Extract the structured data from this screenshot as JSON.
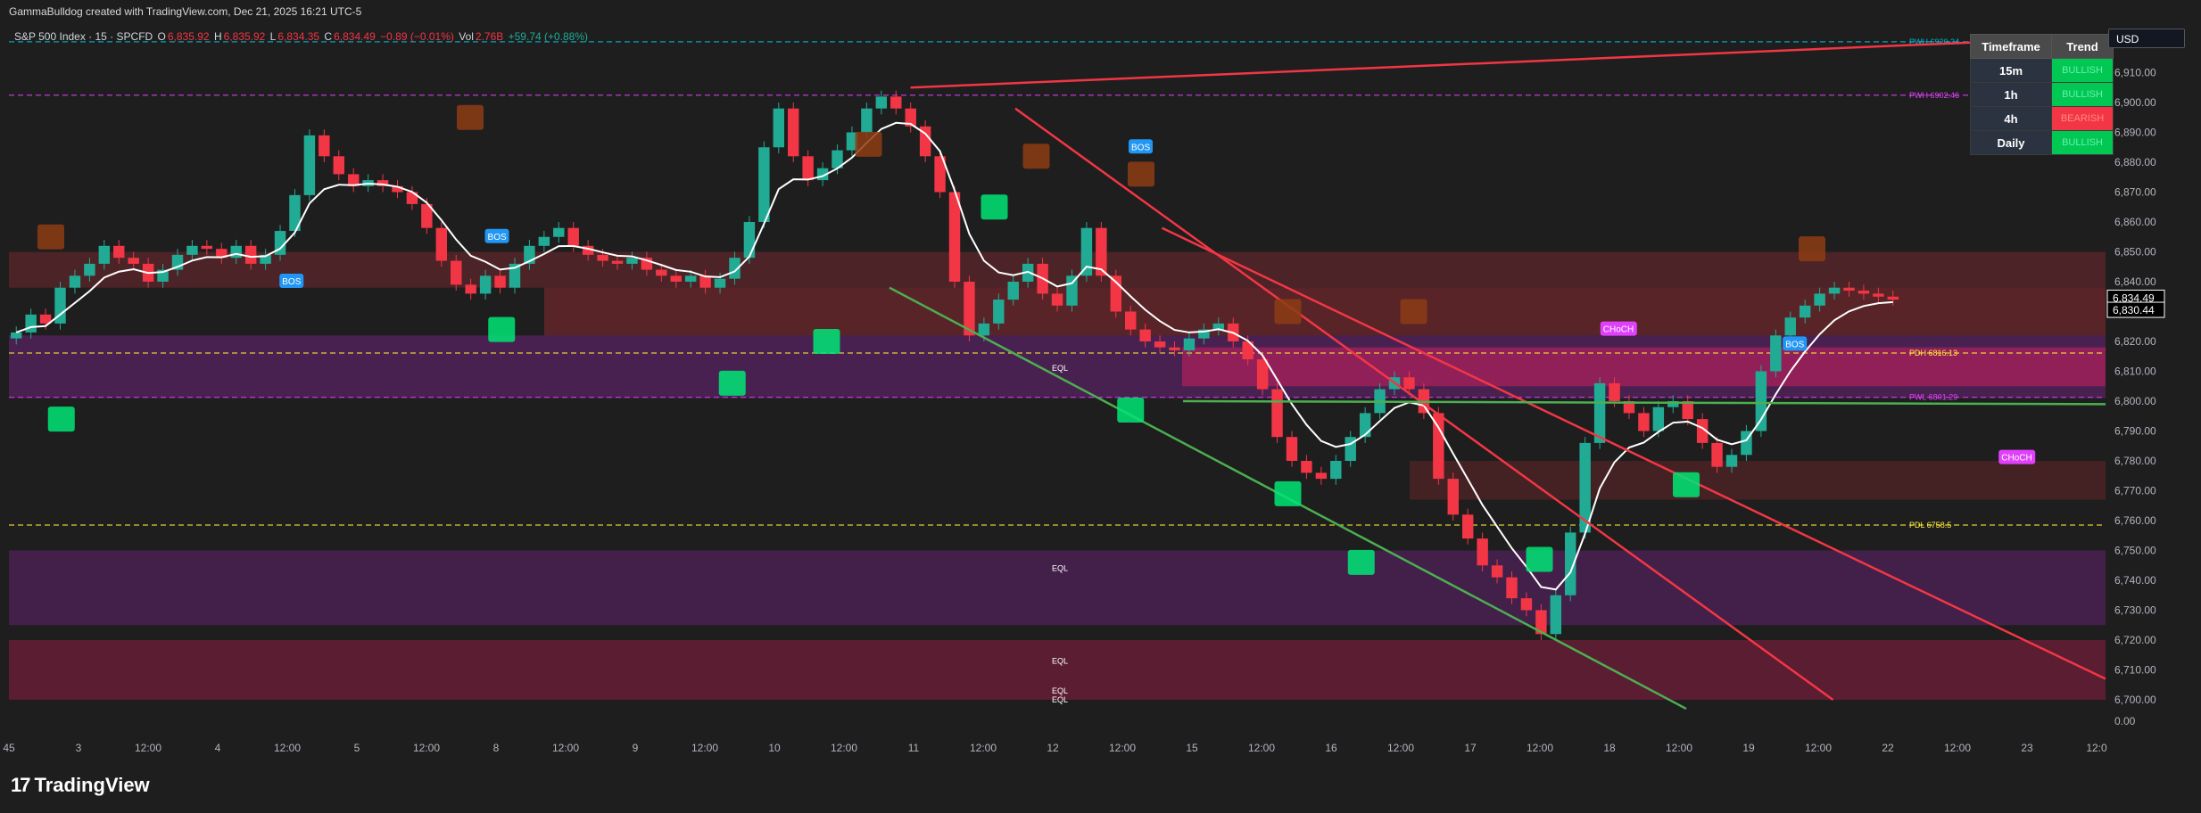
{
  "header": {
    "credit": "GammaBulldog created with TradingView.com, Dec 21, 2025 16:21 UTC-5"
  },
  "legend": {
    "symbol": "S&P 500 Index · 15 · SPCFD",
    "open_label": "O",
    "open": "6,835.92",
    "high_label": "H",
    "high": "6,835.92",
    "low_label": "L",
    "low": "6,834.35",
    "close_label": "C",
    "close": "6,834.49",
    "change": "−0.89 (−0.01%)",
    "vol_label": "Vol",
    "vol": "2.76B",
    "vol_change": "+59.74 (+0.88%)"
  },
  "currency": "USD",
  "brand": "TradingView",
  "trend_table": {
    "headers": [
      "Timeframe",
      "Trend"
    ],
    "rows": [
      {
        "tf": "15m",
        "trend": "BULLISH",
        "color": "#00c853"
      },
      {
        "tf": "1h",
        "trend": "BULLISH",
        "color": "#00c853"
      },
      {
        "tf": "4h",
        "trend": "BEARISH",
        "color": "#f23645"
      },
      {
        "tf": "Daily",
        "trend": "BULLISH",
        "color": "#00c853"
      }
    ]
  },
  "colors": {
    "up": "#22ab94",
    "down": "#f23645",
    "vwap": "#ffffff",
    "trendline_red": "#f23645",
    "trendline_green": "#4caf50",
    "pdh": "#ffeb3b",
    "pwh": "#00bcd4",
    "pwl": "#e040fb"
  },
  "chart_data": {
    "type": "candlestick",
    "ylim": [
      6700,
      6920
    ],
    "y_ticks": [
      "6,920.00",
      "6,910.00",
      "6,900.00",
      "6,890.00",
      "6,880.00",
      "6,870.00",
      "6,860.00",
      "6,850.00",
      "6,840.00",
      "6,830.00",
      "6,820.00",
      "6,810.00",
      "6,800.00",
      "6,790.00",
      "6,780.00",
      "6,770.00",
      "6,760.00",
      "6,750.00",
      "6,740.00",
      "6,730.00",
      "6,720.00",
      "6,710.00",
      "6,700.00"
    ],
    "y_zero_tick": "0.00",
    "x_ticks": [
      "45",
      "3",
      "12:00",
      "4",
      "12:00",
      "5",
      "12:00",
      "8",
      "12:00",
      "9",
      "12:00",
      "10",
      "12:00",
      "11",
      "12:00",
      "12",
      "12:00",
      "15",
      "12:00",
      "16",
      "12:00",
      "17",
      "12:00",
      "18",
      "12:00",
      "19",
      "12:00",
      "22",
      "12:00",
      "23",
      "12:0"
    ],
    "price_labels": [
      {
        "text": "6,834.49",
        "value": 6834.49
      },
      {
        "text": "6,830.44",
        "value": 6830.44
      }
    ],
    "levels": [
      {
        "label": "PWH 6920.34",
        "value": 6920.34,
        "color": "#00bcd4"
      },
      {
        "label": "PWH 6902.46",
        "value": 6902.46,
        "color": "#e040fb"
      },
      {
        "label": "PDH 6816.13",
        "value": 6816.13,
        "color": "#ffeb3b"
      },
      {
        "label": "PWL 6801.29",
        "value": 6801.29,
        "color": "#e040fb"
      },
      {
        "label": "PDL 6758.5",
        "value": 6758.5,
        "color": "#ffeb3b"
      }
    ],
    "eql_labels": [
      {
        "text": "EQL",
        "value": 6811
      },
      {
        "text": "EQL",
        "value": 6744
      },
      {
        "text": "EQL",
        "value": 6713
      },
      {
        "text": "EQL",
        "value": 6703
      },
      {
        "text": "EQL",
        "value": 6700
      }
    ],
    "structure_labels": [
      {
        "text": "BOS",
        "x": 0.135,
        "value": 6840
      },
      {
        "text": "BOS",
        "x": 0.233,
        "value": 6855
      },
      {
        "text": "BOS",
        "x": 0.54,
        "value": 6885
      },
      {
        "text": "CHoCH",
        "x": 0.765,
        "value": 6824
      },
      {
        "text": "BOS",
        "x": 0.852,
        "value": 6819
      },
      {
        "text": "CHoCH",
        "x": 0.955,
        "value": 6781
      }
    ],
    "closes": [
      6823,
      6829,
      6826,
      6838,
      6842,
      6846,
      6852,
      6848,
      6846,
      6840,
      6844,
      6849,
      6852,
      6851,
      6848,
      6852,
      6846,
      6849,
      6857,
      6869,
      6889,
      6882,
      6876,
      6872,
      6874,
      6872,
      6870,
      6866,
      6858,
      6847,
      6839,
      6836,
      6842,
      6838,
      6846,
      6852,
      6855,
      6858,
      6852,
      6849,
      6847,
      6846,
      6848,
      6844,
      6842,
      6840,
      6842,
      6838,
      6841,
      6848,
      6860,
      6885,
      6898,
      6882,
      6874,
      6878,
      6884,
      6890,
      6898,
      6902,
      6898,
      6892,
      6882,
      6870,
      6840,
      6822,
      6826,
      6834,
      6840,
      6846,
      6836,
      6832,
      6842,
      6858,
      6842,
      6830,
      6824,
      6820,
      6818,
      6817,
      6821,
      6824,
      6826,
      6820,
      6814,
      6804,
      6788,
      6780,
      6776,
      6774,
      6780,
      6788,
      6796,
      6804,
      6808,
      6804,
      6796,
      6774,
      6762,
      6754,
      6745,
      6741,
      6734,
      6730,
      6722,
      6735,
      6756,
      6786,
      6806,
      6800,
      6796,
      6790,
      6798,
      6800,
      6794,
      6786,
      6778,
      6782,
      6790,
      6810,
      6822,
      6828,
      6832,
      6836,
      6838,
      6837,
      6836,
      6835,
      6834
    ]
  }
}
